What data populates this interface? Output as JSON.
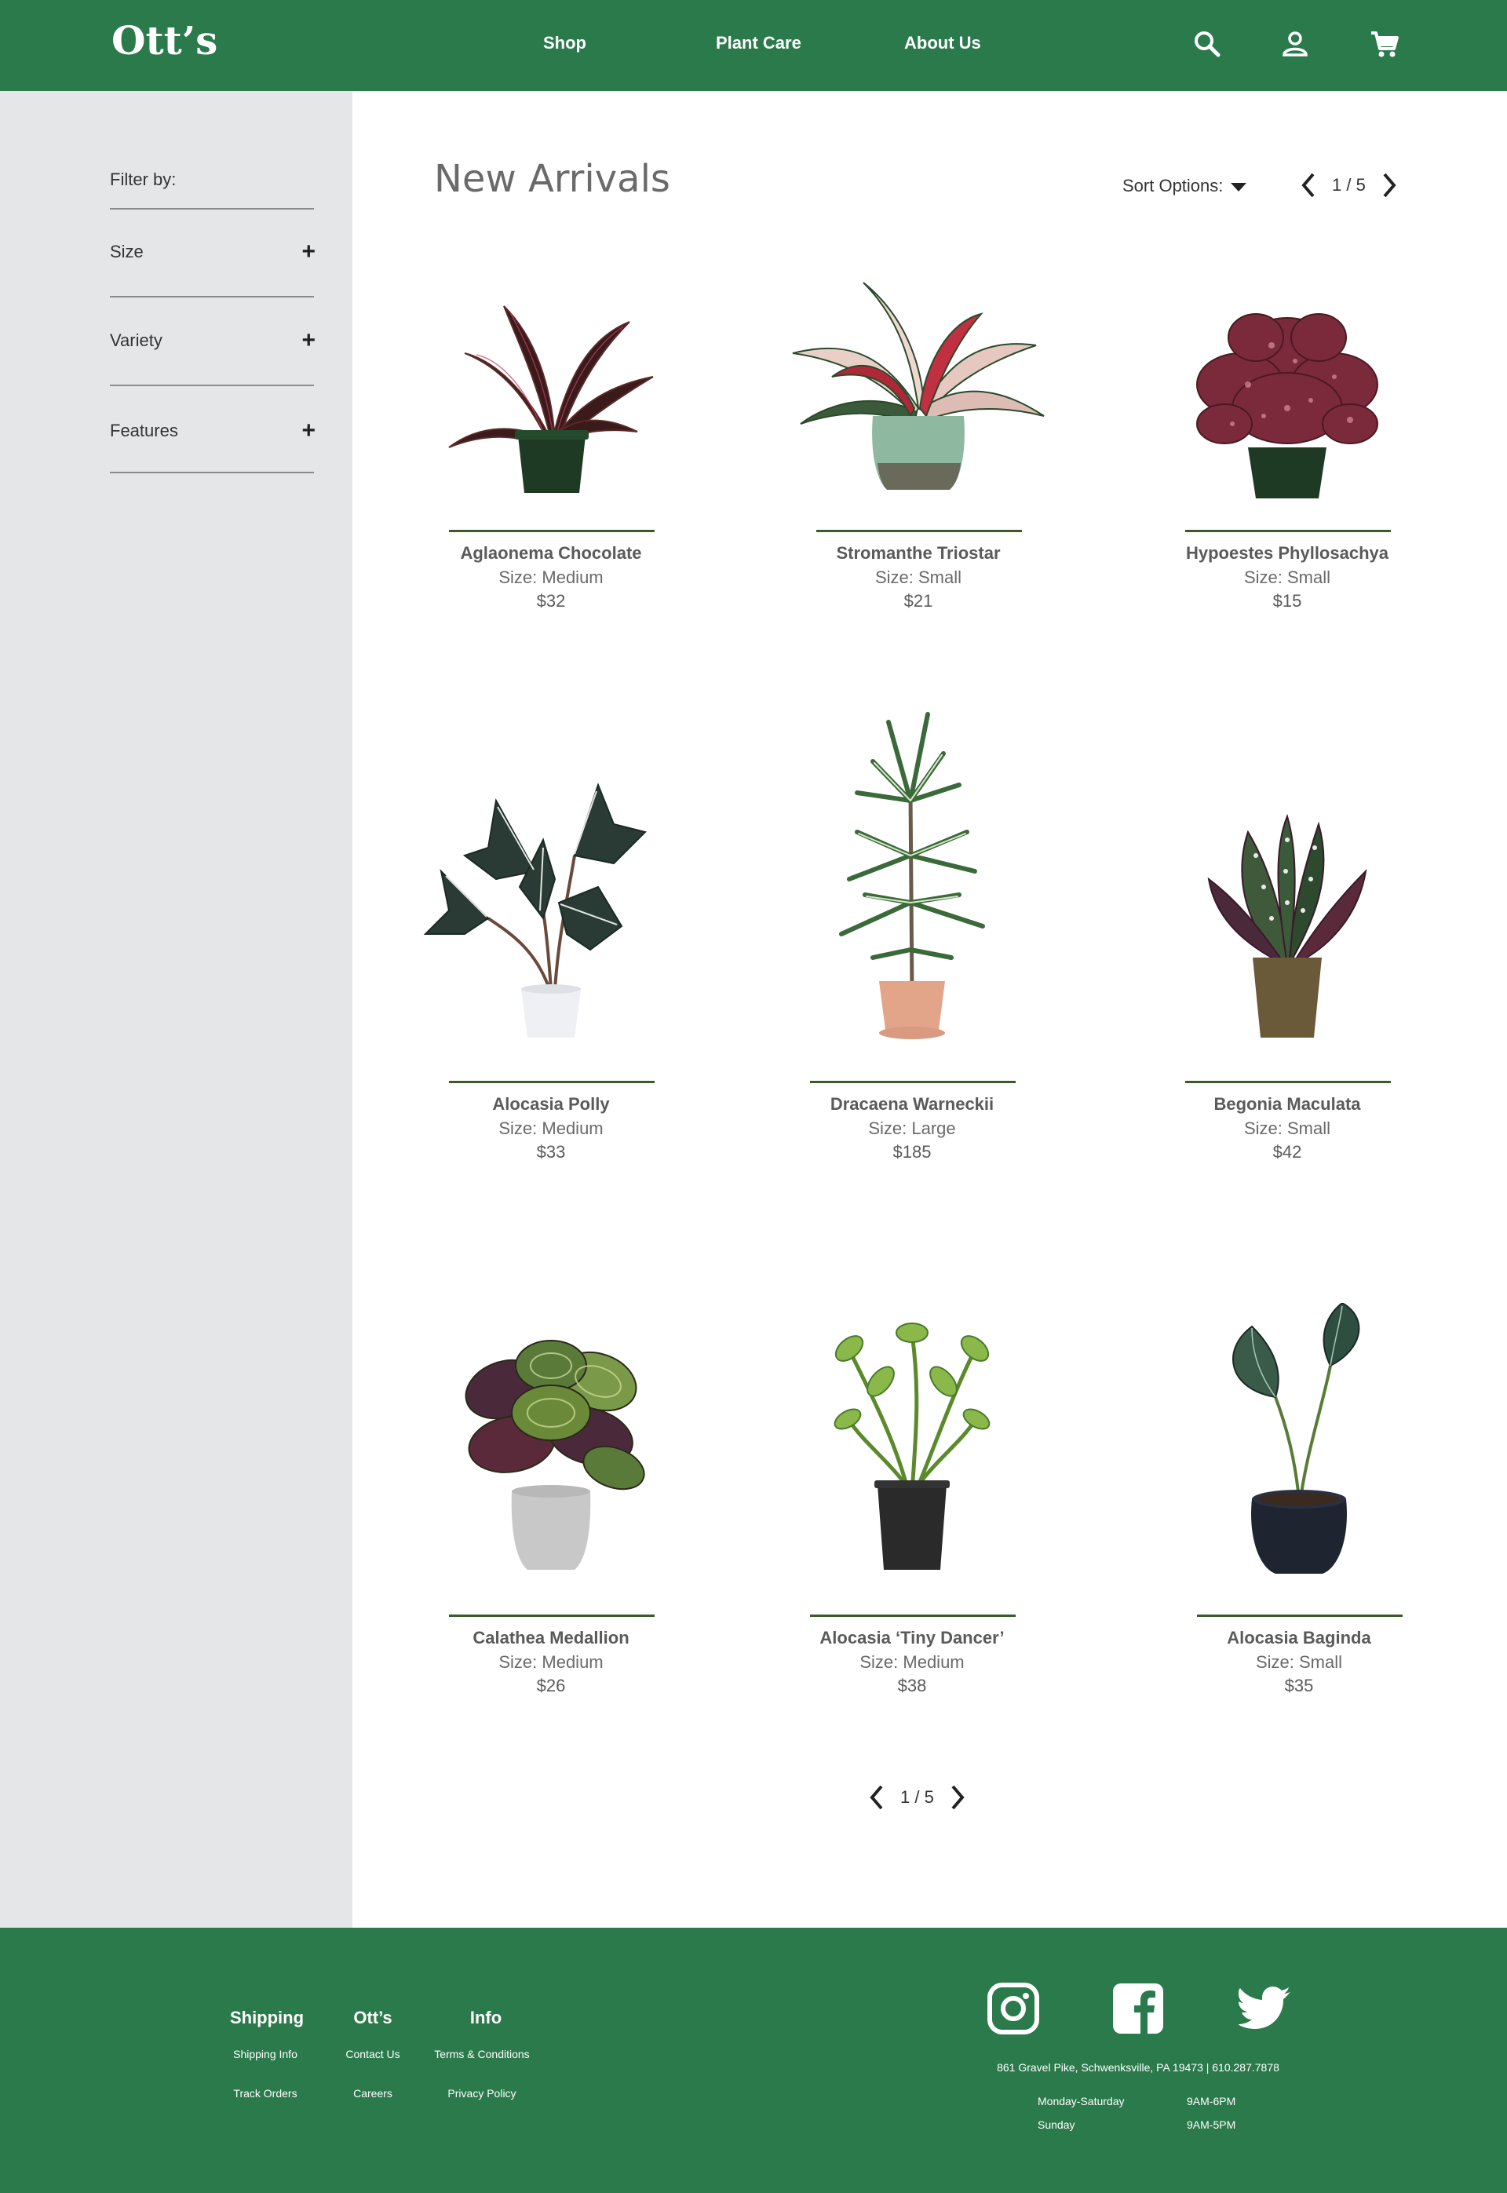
{
  "header": {
    "logo": "Ott’s",
    "nav": [
      {
        "label": "Shop"
      },
      {
        "label": "Plant Care"
      },
      {
        "label": "About Us"
      }
    ],
    "icons": [
      "search-icon",
      "account-icon",
      "cart-icon"
    ]
  },
  "sidebar": {
    "filter_title": "Filter by:",
    "filters": [
      {
        "label": "Size",
        "toggle": "+"
      },
      {
        "label": "Variety",
        "toggle": "+"
      },
      {
        "label": "Features",
        "toggle": "+"
      }
    ]
  },
  "main": {
    "title": "New Arrivals",
    "sort_label": "Sort Options:",
    "pagination": {
      "text": "1 / 5"
    },
    "products": [
      {
        "name": "Aglaonema Chocolate",
        "size": "Size: Medium",
        "price": "$32"
      },
      {
        "name": "Stromanthe Triostar",
        "size": "Size: Small",
        "price": "$21"
      },
      {
        "name": "Hypoestes Phyllosachya",
        "size": "Size: Small",
        "price": "$15"
      },
      {
        "name": "Alocasia Polly",
        "size": "Size: Medium",
        "price": "$33"
      },
      {
        "name": "Dracaena Warneckii",
        "size": "Size: Large",
        "price": "$185"
      },
      {
        "name": "Begonia Maculata",
        "size": "Size: Small",
        "price": "$42"
      },
      {
        "name": "Calathea Medallion",
        "size": "Size: Medium",
        "price": "$26"
      },
      {
        "name": "Alocasia ‘Tiny Dancer’",
        "size": "Size: Medium",
        "price": "$38"
      },
      {
        "name": "Alocasia Baginda",
        "size": "Size: Small",
        "price": "$35"
      }
    ]
  },
  "footer": {
    "columns": [
      {
        "title": "Shipping",
        "links": [
          "Shipping Info",
          "Track Orders"
        ]
      },
      {
        "title": "Ott’s",
        "links": [
          "Contact Us",
          "Careers"
        ]
      },
      {
        "title": "Info",
        "links": [
          "Terms & Conditions",
          "Privacy Policy"
        ]
      }
    ],
    "social": [
      "instagram-icon",
      "facebook-icon",
      "twitter-icon"
    ],
    "address": "861 Gravel Pike, Schwenksville, PA 19473 | 610.287.7878",
    "hours": [
      {
        "days": "Monday-Saturday",
        "time": "9AM-6PM"
      },
      {
        "days": "Sunday",
        "time": "9AM-5PM"
      }
    ]
  },
  "colors": {
    "brand_green": "#2b7a4b",
    "sidebar_gray": "#e5e6e8",
    "card_line": "#3a5a2b"
  }
}
